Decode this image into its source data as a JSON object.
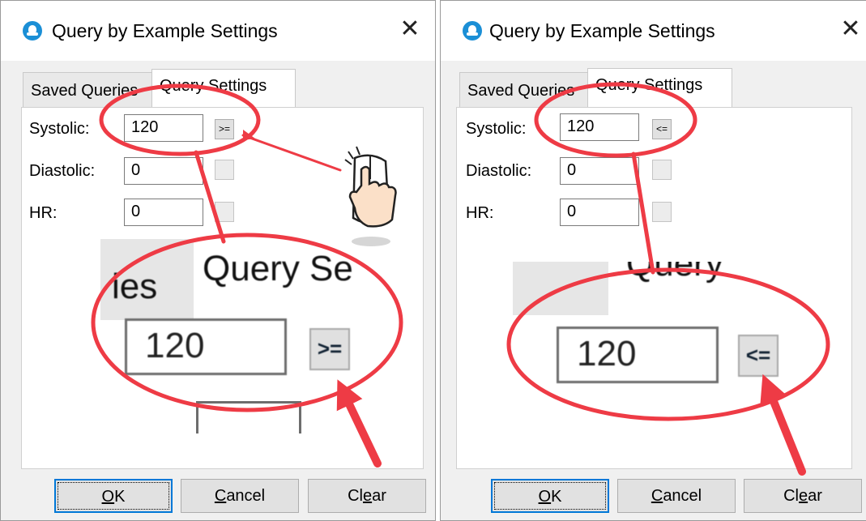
{
  "dialogs": [
    {
      "title": "Query by Example Settings",
      "close_glyph": "✕",
      "tabs": [
        {
          "label": "Saved Queries",
          "active": false
        },
        {
          "label": "Query Settings",
          "active": true
        }
      ],
      "fields": [
        {
          "label": "Systolic:",
          "value": "120",
          "operator": ">="
        },
        {
          "label": "Diastolic:",
          "value": "0",
          "operator": ""
        },
        {
          "label": "HR:",
          "value": "0",
          "operator": ""
        }
      ],
      "zoom": {
        "tab_partial_left": "ies",
        "tab_label": "Query Se",
        "value": "120",
        "operator": ">="
      },
      "buttons": [
        {
          "pre": "",
          "accel": "O",
          "post": "K",
          "default": true
        },
        {
          "pre": "",
          "accel": "C",
          "post": "ancel",
          "default": false
        },
        {
          "pre": "Cl",
          "accel": "e",
          "post": "ar",
          "default": false
        }
      ]
    },
    {
      "title": "Query by Example Settings",
      "close_glyph": "✕",
      "tabs": [
        {
          "label": "Saved Queries",
          "active": false
        },
        {
          "label": "Query Settings",
          "active": true
        }
      ],
      "fields": [
        {
          "label": "Systolic:",
          "value": "120",
          "operator": "<="
        },
        {
          "label": "Diastolic:",
          "value": "0",
          "operator": ""
        },
        {
          "label": "HR:",
          "value": "0",
          "operator": ""
        }
      ],
      "zoom": {
        "tab_partial_left": "",
        "tab_label": "Query",
        "value": "120",
        "operator": "<="
      },
      "buttons": [
        {
          "pre": "",
          "accel": "O",
          "post": "K",
          "default": true
        },
        {
          "pre": "",
          "accel": "C",
          "post": "ancel",
          "default": false
        },
        {
          "pre": "Cl",
          "accel": "e",
          "post": "ar",
          "default": false
        }
      ]
    }
  ],
  "annotations": {
    "highlight_color": "#ee3b45",
    "cursor_icon": "hand-pointer-mouse-icon"
  }
}
